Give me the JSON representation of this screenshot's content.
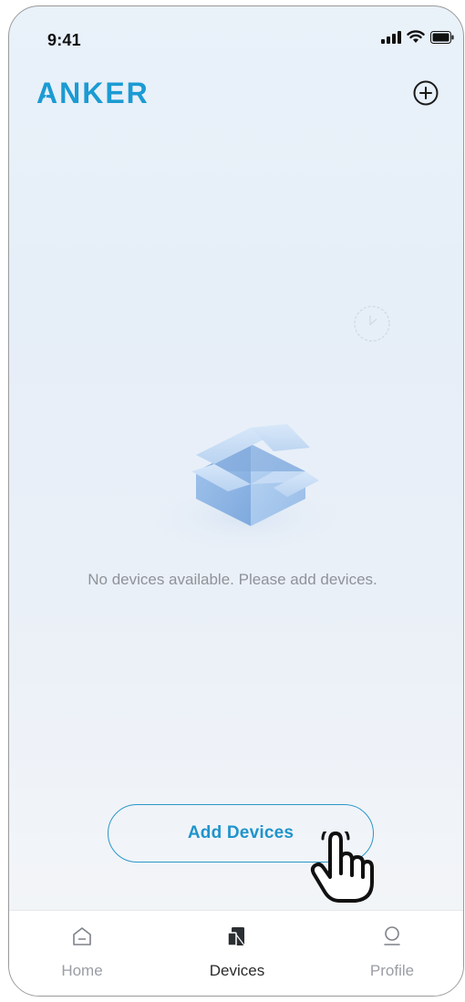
{
  "status_bar": {
    "time": "9:41",
    "icons": [
      "signal-icon",
      "wifi-icon",
      "battery-icon"
    ]
  },
  "header": {
    "logo_text": "ANKER",
    "add_icon": "plus-circle-icon"
  },
  "empty_state": {
    "message": "No devices available. Please add devices.",
    "illustration": "open-box-icon"
  },
  "actions": {
    "add_devices_label": "Add Devices"
  },
  "tab_bar": {
    "items": [
      {
        "label": "Home",
        "icon": "home-icon",
        "active": false
      },
      {
        "label": "Devices",
        "icon": "devices-icon",
        "active": true
      },
      {
        "label": "Profile",
        "icon": "profile-icon",
        "active": false
      }
    ]
  },
  "colors": {
    "accent": "#1f94cc",
    "brand": "#1b9bd3",
    "text_muted": "#8e9399",
    "tab_active": "#2b2b2b",
    "tab_inactive": "#9a9ea4"
  }
}
